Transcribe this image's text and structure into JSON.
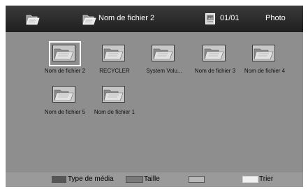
{
  "header": {
    "root_icon": "folder-open-icon",
    "folder_icon": "folder-open-icon",
    "folder_title": "Nom de fichier 2",
    "page_icon": "photo-file-icon",
    "page_indicator": "01/01",
    "media_mode": "Photo"
  },
  "files": [
    {
      "label": "Nom de fichier 2",
      "selected": true
    },
    {
      "label": "RECYCLER",
      "selected": false
    },
    {
      "label": "System Volu...",
      "selected": false
    },
    {
      "label": "Nom de fichier 3",
      "selected": false
    },
    {
      "label": "Nom de fichier 4",
      "selected": false
    },
    {
      "label": "Nom de fichier 5",
      "selected": false
    },
    {
      "label": "Nom de fichier 1",
      "selected": false
    }
  ],
  "footer": {
    "red_label": "Type de média",
    "green_label": "Taille",
    "yellow_label": "",
    "blue_label": "Trier"
  },
  "colors": {
    "screen_bg": "#8e8e8e",
    "header_bg": "#2a2a2a",
    "footer_bg": "#9a9a9a",
    "selection_border": "#ffffff"
  }
}
